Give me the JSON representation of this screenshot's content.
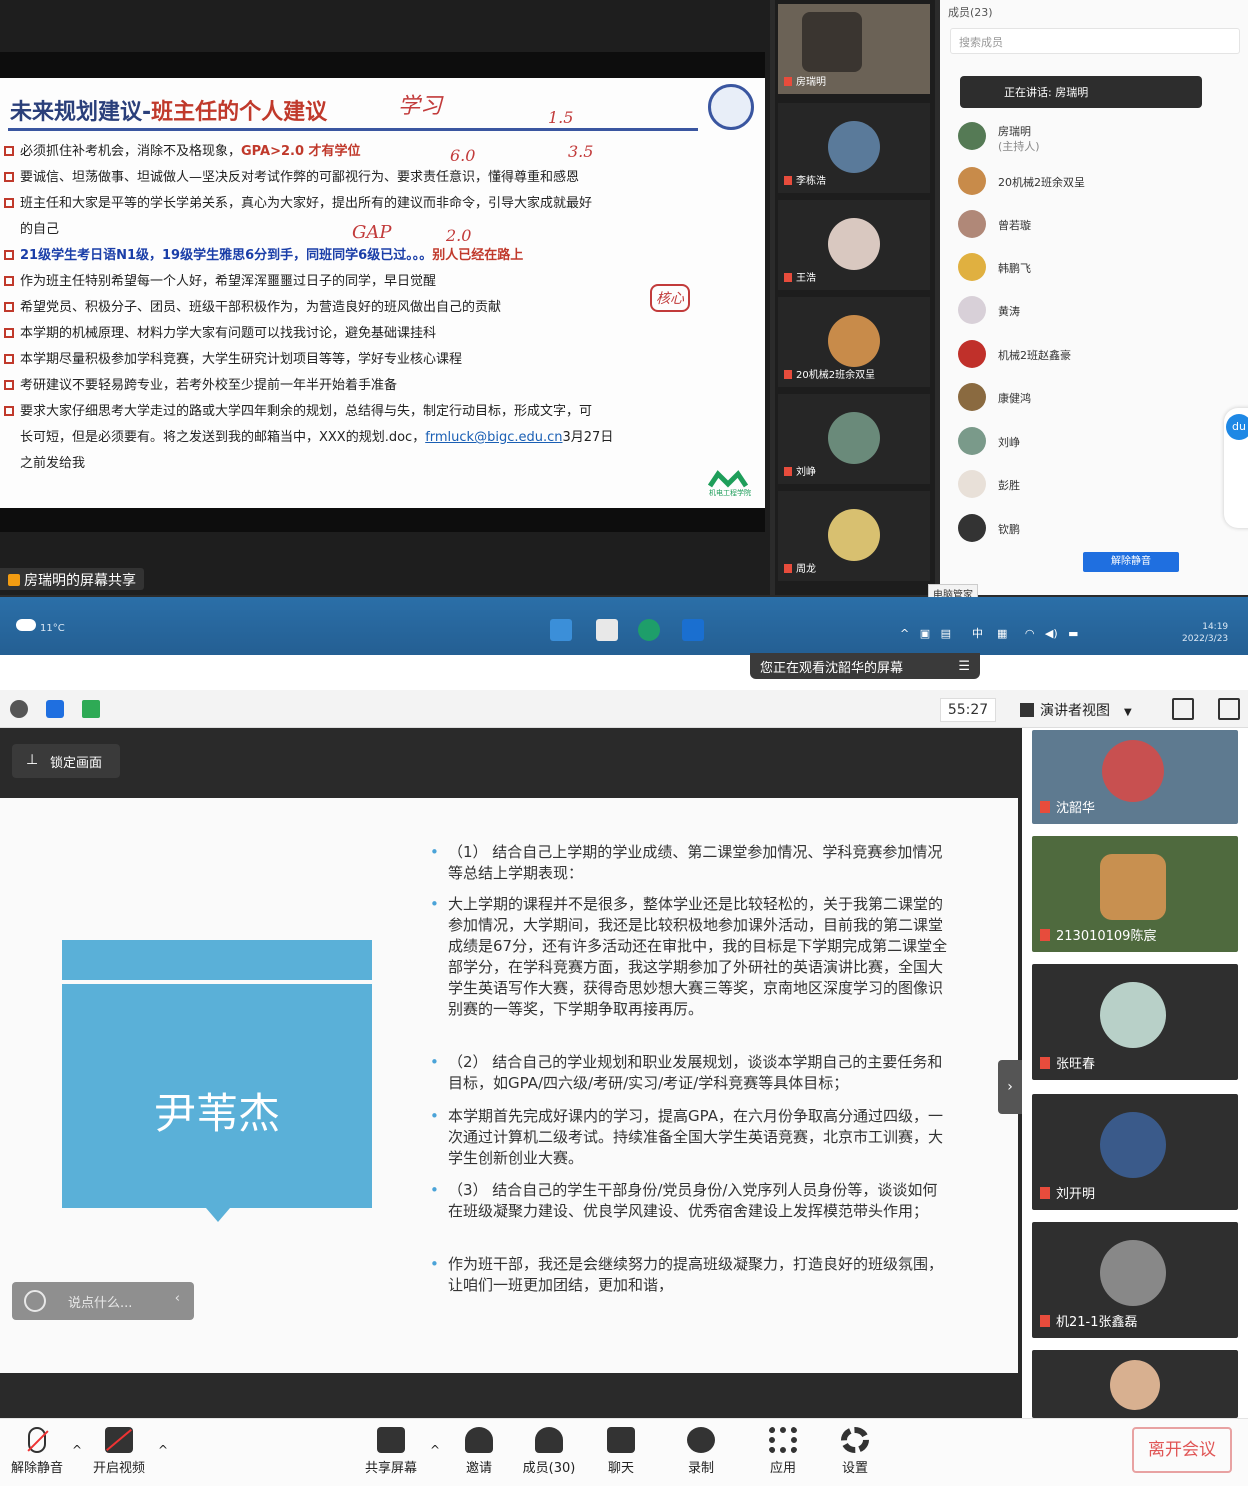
{
  "top": {
    "slide": {
      "title_prefix": "未来规划建议-",
      "title_main": "班主任的个人建议",
      "items": [
        {
          "pre": "必须抓住补考机会，消除不及格现象，",
          "hl": "GPA>2.0 才有学位",
          "post": ""
        },
        {
          "pre": "要诚信、坦荡做事、坦诚做人—坚决反对考试作弊的可鄙视行为、要求责任意识，懂得尊重和感恩",
          "hl": "",
          "post": ""
        },
        {
          "pre": "班主任和大家是平等的学长学弟关系，真心为大家好，提出所有的建议而非命令，引导大家成就最好",
          "hl": "",
          "post": ""
        },
        {
          "pre": "",
          "hl_blue": "21级学生考日语N1级，19级学生雅思6分到手，同班同学6级已过。。。",
          "hl": "别人已经在路上",
          "post": ""
        },
        {
          "pre": "作为班主任特别希望每一个人好，希望浑浑噩噩过日子的同学，早日觉醒",
          "hl": "",
          "post": ""
        },
        {
          "pre": "希望党员、积极分子、团员、班级干部积极作为，为营造良好的班风做出自己的贡献",
          "hl": "",
          "post": ""
        },
        {
          "pre": "本学期的机械原理、材料力学大家有问题可以找我讨论，避免基础课挂科",
          "hl": "",
          "post": ""
        },
        {
          "pre": "本学期尽量积极参加学科竞赛，大学生研究计划项目等等，学好专业核心课程",
          "hl": "",
          "post": ""
        },
        {
          "pre": "考研建议不要轻易跨专业，若考外校至少提前一年半开始着手准备",
          "hl": "",
          "post": ""
        },
        {
          "pre": "要求大家仔细思考大学走过的路或大学四年剩余的规划，总结得与失，制定行动目标，形成文字，可",
          "hl": "",
          "post": ""
        }
      ],
      "item3_cont": "的自己",
      "item10_cont_pre": "长可短，但是必须要有。将之发送到我的邮箱当中，XXX的规划.doc，",
      "email": "frmluck@bigc.edu.cn",
      "item10_cont_post": "3月27日",
      "item10_cont2": "之前发给我",
      "brand": "机电工程学院",
      "hand_notes": [
        "学习",
        "1.5",
        "6.0",
        "3.5",
        "GAP",
        "2.0",
        "核心"
      ],
      "share_label": "房瑞明的屏幕共享"
    },
    "gallery": [
      {
        "name": "房瑞明"
      },
      {
        "name": "李栋浩"
      },
      {
        "name": "王浩"
      },
      {
        "name": "20机械2班余双呈"
      },
      {
        "name": "刘峥"
      },
      {
        "name": "周龙"
      }
    ],
    "members": {
      "header": "成员(23)",
      "search_placeholder": "搜索成员",
      "speaking": "正在讲话: 房瑞明",
      "list": [
        {
          "name": "房瑞明",
          "sub": "(主持人)"
        },
        {
          "name": "20机械2班余双呈",
          "sub": ""
        },
        {
          "name": "曾若璇",
          "sub": ""
        },
        {
          "name": "韩鹏飞",
          "sub": ""
        },
        {
          "name": "黄涛",
          "sub": ""
        },
        {
          "name": "机械2班赵鑫豪",
          "sub": ""
        },
        {
          "name": "康健鸿",
          "sub": ""
        },
        {
          "name": "刘峥",
          "sub": ""
        },
        {
          "name": "彭胜",
          "sub": ""
        },
        {
          "name": "钦鹏",
          "sub": ""
        }
      ],
      "unmute_all": "解除静音"
    },
    "taskbar": {
      "tooltip": "电脑管家",
      "weather": "11°C",
      "ime": "中",
      "time": "14:19",
      "date": "2022/3/23"
    }
  },
  "bottom": {
    "viewing_banner": "您正在观看沈韶华的屏幕",
    "timer": "55:27",
    "view_mode": "演讲者视图",
    "lock_label": "锁定画面",
    "slide": {
      "name": "尹苇杰",
      "paragraphs": [
        "（1） 结合自己上学期的学业成绩、第二课堂参加情况、学科竞赛参加情况等总结上学期表现：",
        "大上学期的课程并不是很多，整体学业还是比较轻松的，关于我第二课堂的参加情况，大学期间，我还是比较积极地参加课外活动，目前我的第二课堂成绩是67分，还有许多活动还在审批中，我的目标是下学期完成第二课堂全部学分，在学科竞赛方面，我这学期参加了外研社的英语演讲比赛，全国大学生英语写作大赛，获得奇思妙想大赛三等奖，京南地区深度学习的图像识别赛的一等奖，下学期争取再接再厉。",
        "（2） 结合自己的学业规划和职业发展规划，谈谈本学期自己的主要任务和目标，如GPA/四六级/考研/实习/考证/学科竞赛等具体目标；",
        "本学期首先完成好课内的学习，提高GPA，在六月份争取高分通过四级，一次通过计算机二级考试。持续准备全国大学生英语竞赛，北京市工训赛，大学生创新创业大赛。",
        "（3） 结合自己的学生干部身份/党员身份/入党序列人员身份等，谈谈如何在班级凝聚力建设、优良学风建设、优秀宿舍建设上发挥模范带头作用；",
        "作为班干部，我还是会继续努力的提高班级凝聚力，打造良好的班级氛围，让咱们一班更加团结，更加和谐，"
      ]
    },
    "comment_placeholder": "说点什么...",
    "gallery": [
      {
        "name": "沈韶华"
      },
      {
        "name": "213010109陈宸"
      },
      {
        "name": "张旺春"
      },
      {
        "name": "刘开明"
      },
      {
        "name": "机21-1张鑫磊"
      }
    ],
    "controls": {
      "unmute": "解除静音",
      "video": "开启视频",
      "share": "共享屏幕",
      "invite": "邀请",
      "members": "成员(30)",
      "chat": "聊天",
      "record": "录制",
      "apps": "应用",
      "settings": "设置",
      "leave": "离开会议"
    }
  }
}
